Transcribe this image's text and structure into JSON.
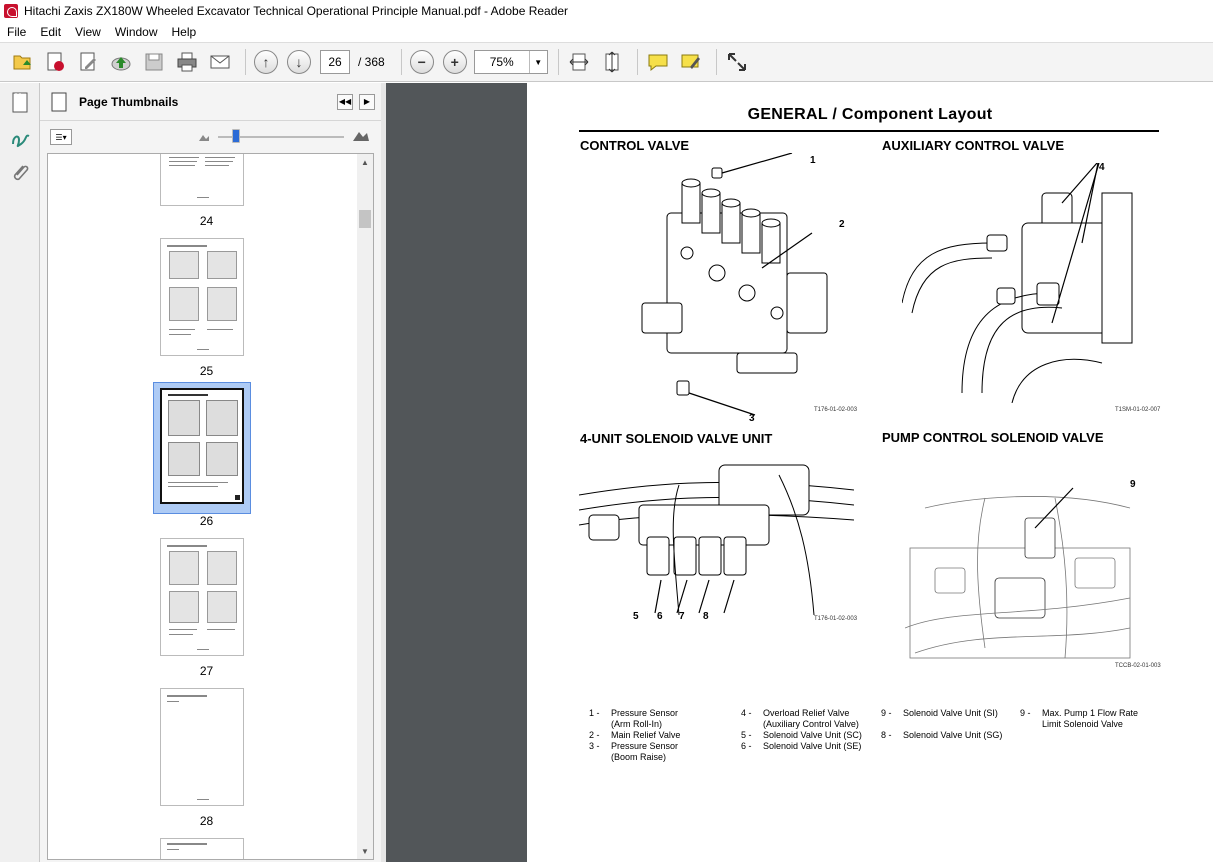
{
  "window": {
    "title": "Hitachi Zaxis ZX180W Wheeled Excavator Technical Operational Principle Manual.pdf - Adobe Reader"
  },
  "menu": [
    "File",
    "Edit",
    "View",
    "Window",
    "Help"
  ],
  "toolbar": {
    "page_number": "26",
    "page_total": "/  368",
    "zoom": "75%"
  },
  "panel": {
    "title": "Page Thumbnails",
    "thumbnails": [
      {
        "label": "24"
      },
      {
        "label": "25"
      },
      {
        "label": "26",
        "selected": true
      },
      {
        "label": "27"
      },
      {
        "label": "28"
      }
    ]
  },
  "document": {
    "page_title": "GENERAL / Component Layout",
    "sections": {
      "control_valve": "CONTROL VALVE",
      "auxiliary": "AUXILIARY CONTROL VALVE",
      "solenoid_unit": "4-UNIT SOLENOID VALVE UNIT",
      "pump_control": "PUMP CONTROL SOLENOID VALVE"
    },
    "figure_refs": {
      "control_valve": "T176-01-02-003",
      "auxiliary": "T1SM-01-02-007",
      "solenoid_unit": "T176-01-02-003",
      "pump_control": "TCCB-02-01-003"
    },
    "callouts": [
      "1",
      "2",
      "3",
      "4",
      "5",
      "6",
      "7",
      "8",
      "9"
    ],
    "legend": [
      {
        "num": "1 -",
        "text": "Pressure Sensor",
        "text2": "(Arm Roll-In)"
      },
      {
        "num": "2 -",
        "text": "Main Relief Valve"
      },
      {
        "num": "3 -",
        "text": "Pressure Sensor",
        "text2": "(Boom Raise)"
      },
      {
        "num": "4 -",
        "text": "Overload Relief Valve",
        "text2": "(Auxiliary Control Valve)"
      },
      {
        "num": "5 -",
        "text": "Solenoid Valve Unit (SC)"
      },
      {
        "num": "6 -",
        "text": "Solenoid Valve Unit (SE)"
      },
      {
        "num": "9 -",
        "text": "Solenoid Valve Unit (SI)"
      },
      {
        "num": "8 -",
        "text": "Solenoid Valve Unit (SG)"
      },
      {
        "num": "9 -",
        "text": "Max. Pump 1 Flow Rate",
        "text2": "Limit Solenoid Valve"
      }
    ]
  }
}
